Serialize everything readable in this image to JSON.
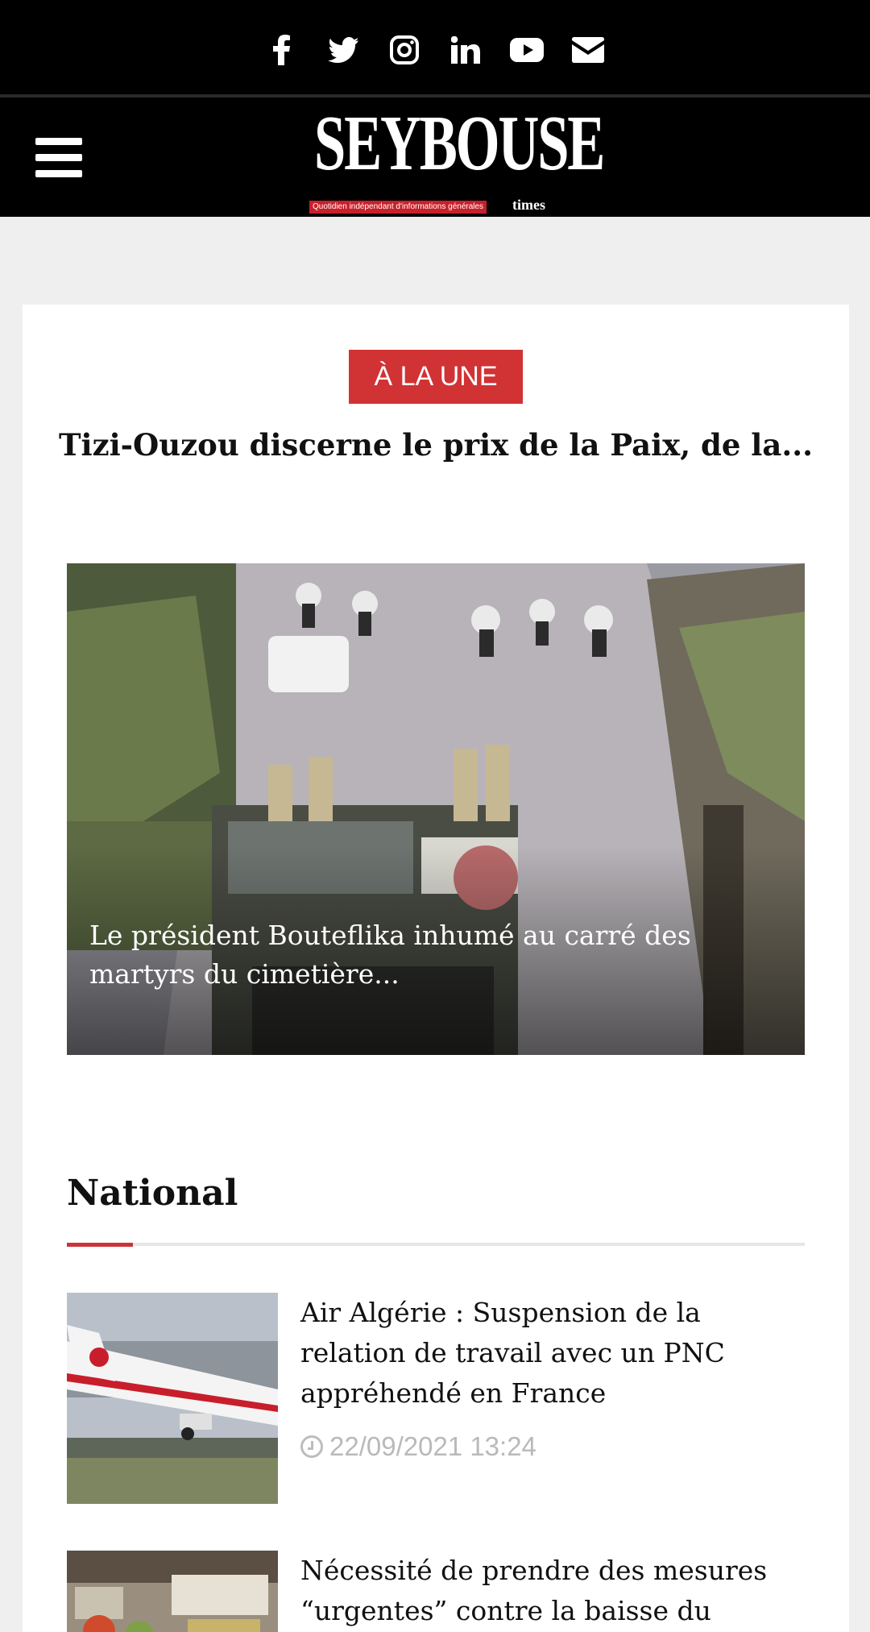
{
  "social": {
    "icons": [
      "facebook-icon",
      "twitter-icon",
      "instagram-icon",
      "linkedin-icon",
      "youtube-icon",
      "email-icon"
    ]
  },
  "header": {
    "logo_word": "SEYBOUSE",
    "logo_tagline": "Quotidien indépendant d'informations générales",
    "logo_suffix": "times",
    "menu_icon": "hamburger-icon"
  },
  "featured": {
    "badge": "À LA UNE",
    "headline": "Tizi-Ouzou discerne le prix de la Paix, de la...",
    "hero_caption": "Le président Bouteflika inhumé au carré des martyrs du cimetière..."
  },
  "national": {
    "title": "National",
    "articles": [
      {
        "title": "Air Algérie : Suspension de la relation de travail avec un PNC appréhendé en France",
        "date": "22/09/2021 13:24"
      },
      {
        "title": "Nécessité de prendre des mesures “urgentes” contre la baisse du"
      }
    ]
  },
  "colors": {
    "accent_red": "#d13234",
    "header_bg": "#000000",
    "page_bg": "#efefef",
    "date_gray": "#b9b9b9"
  }
}
